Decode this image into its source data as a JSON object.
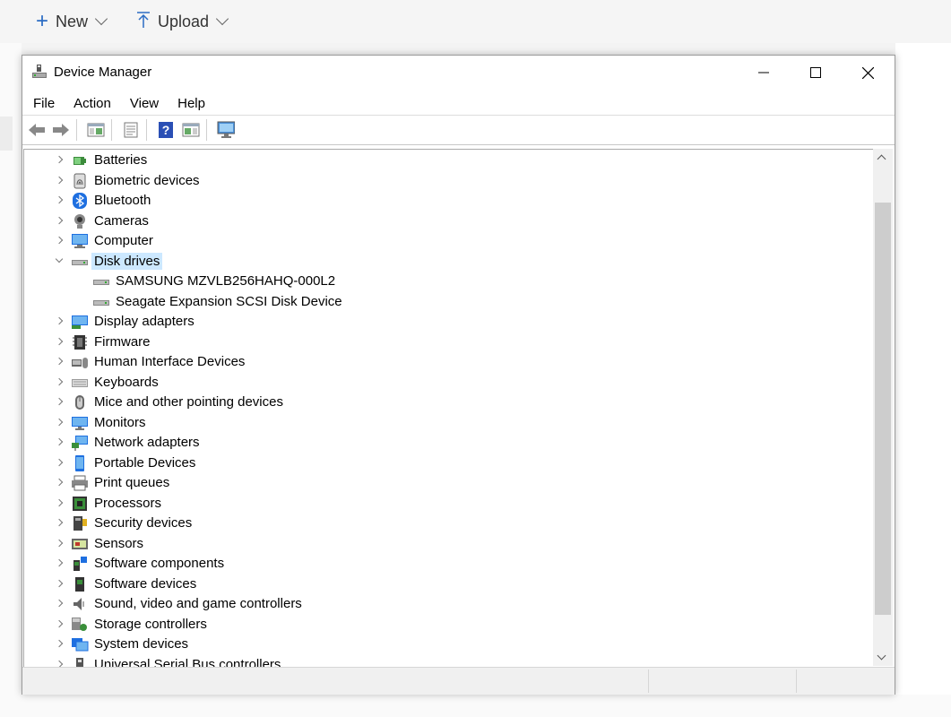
{
  "topbar": {
    "new_label": "New",
    "upload_label": "Upload"
  },
  "window": {
    "title": "Device Manager",
    "menus": [
      "File",
      "Action",
      "View",
      "Help"
    ]
  },
  "tree": {
    "items": [
      {
        "label": "Batteries",
        "icon": "battery-icon"
      },
      {
        "label": "Biometric devices",
        "icon": "fingerprint-icon"
      },
      {
        "label": "Bluetooth",
        "icon": "bluetooth-icon"
      },
      {
        "label": "Cameras",
        "icon": "camera-icon"
      },
      {
        "label": "Computer",
        "icon": "computer-icon"
      },
      {
        "label": "Disk drives",
        "icon": "disk-drive-icon",
        "expanded": true,
        "selected": true
      },
      {
        "label": "SAMSUNG MZVLB256HAHQ-000L2",
        "icon": "disk-drive-icon",
        "child": true
      },
      {
        "label": "Seagate Expansion SCSI Disk Device",
        "icon": "disk-drive-icon",
        "child": true
      },
      {
        "label": "Display adapters",
        "icon": "display-adapter-icon"
      },
      {
        "label": "Firmware",
        "icon": "firmware-icon"
      },
      {
        "label": "Human Interface Devices",
        "icon": "hid-icon"
      },
      {
        "label": "Keyboards",
        "icon": "keyboard-icon"
      },
      {
        "label": "Mice and other pointing devices",
        "icon": "mouse-icon"
      },
      {
        "label": "Monitors",
        "icon": "monitor-icon"
      },
      {
        "label": "Network adapters",
        "icon": "network-adapter-icon"
      },
      {
        "label": "Portable Devices",
        "icon": "portable-device-icon"
      },
      {
        "label": "Print queues",
        "icon": "printer-icon"
      },
      {
        "label": "Processors",
        "icon": "processor-icon"
      },
      {
        "label": "Security devices",
        "icon": "security-device-icon"
      },
      {
        "label": "Sensors",
        "icon": "sensor-icon"
      },
      {
        "label": "Software components",
        "icon": "software-component-icon"
      },
      {
        "label": "Software devices",
        "icon": "software-device-icon"
      },
      {
        "label": "Sound, video and game controllers",
        "icon": "speaker-icon"
      },
      {
        "label": "Storage controllers",
        "icon": "storage-controller-icon"
      },
      {
        "label": "System devices",
        "icon": "system-device-icon"
      },
      {
        "label": "Universal Serial Bus controllers",
        "icon": "usb-icon"
      }
    ]
  },
  "colors": {
    "selection": "#cce8ff",
    "accent": "#2b6cc4"
  }
}
